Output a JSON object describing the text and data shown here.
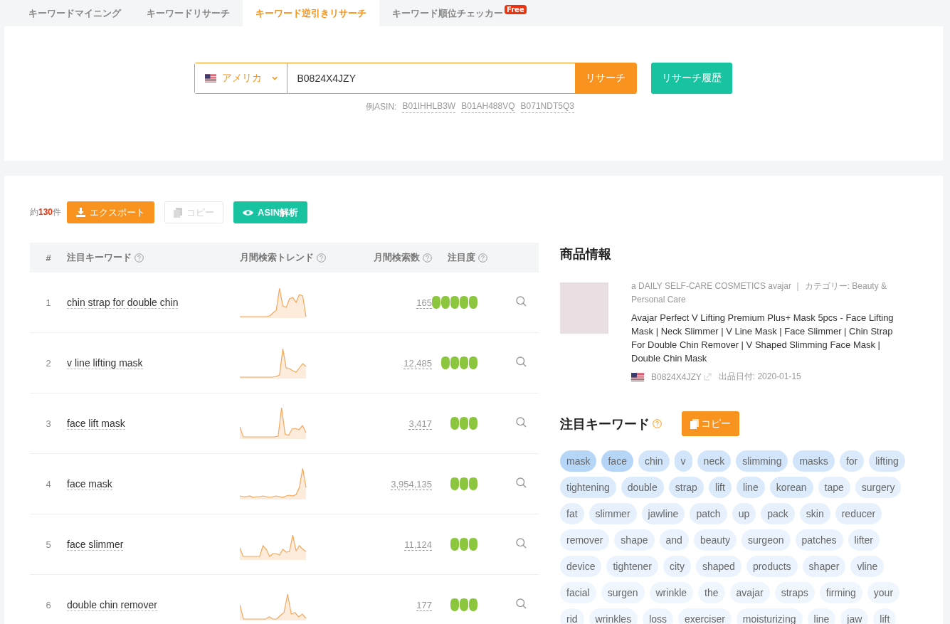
{
  "tabs": [
    {
      "label": "キーワードマイニング",
      "selected": false
    },
    {
      "label": "キーワードリサーチ",
      "selected": false
    },
    {
      "label": "キーワード逆引きリサーチ",
      "selected": true
    },
    {
      "label": "キーワード順位チェッカー",
      "selected": false,
      "badge": "Free"
    }
  ],
  "search": {
    "country": "アメリカ",
    "value": "B0824X4JZY",
    "button": "リサーチ",
    "history_button": "リサーチ履歴",
    "example_label": "例ASIN:",
    "examples": [
      "B01IHHLB3W",
      "B01AH488VQ",
      "B071NDT5Q3"
    ]
  },
  "results": {
    "count_prefix": "約",
    "count": "130",
    "count_suffix": "件",
    "buttons": [
      {
        "kind": "export",
        "label": "エクスポート",
        "disabled": false
      },
      {
        "kind": "copy",
        "label": "コピー",
        "disabled": true
      },
      {
        "kind": "analyze",
        "label": "ASIN解析",
        "disabled": false
      }
    ]
  },
  "table": {
    "columns": [
      {
        "label": "#",
        "help": false
      },
      {
        "label": "注目キーワード",
        "help": true
      },
      {
        "label": "月間検索トレンド",
        "help": true
      },
      {
        "label": "月間検索数",
        "help": true
      },
      {
        "label": "注目度",
        "help": true
      }
    ],
    "rows": [
      {
        "index": "1",
        "keyword": "chin strap for double chin",
        "searches": "165",
        "stars": 5
      },
      {
        "index": "2",
        "keyword": "v line lifting mask",
        "searches": "12,485",
        "stars": 4
      },
      {
        "index": "3",
        "keyword": "face lift mask",
        "searches": "3,417",
        "stars": 3
      },
      {
        "index": "4",
        "keyword": "face mask",
        "searches": "3,954,135",
        "stars": 3
      },
      {
        "index": "5",
        "keyword": "face slimmer",
        "searches": "11,124",
        "stars": 3
      },
      {
        "index": "6",
        "keyword": "double chin remover",
        "searches": "177",
        "stars": 3
      }
    ]
  },
  "product": {
    "title": "商品情報",
    "brand_line": "a DAILY SELF-CARE COSMETICS avajar ｜ カテゴリー: Beauty & Personal Care",
    "name": "Avajar Perfect V Lifting Premium Plus+ Mask 5pcs - Face Lifting Mask | Neck Slimmer | V Line Mask | Face Slimmer | Chin Strap For Double Chin Remover | V Shaped Slimming Face Mask | Double Chin Mask",
    "asin": "B0824X4JZY",
    "date": "出品日付: 2020-01-15"
  },
  "keywords": {
    "title": "注目キーワード",
    "copy_button": "コピー",
    "tags": [
      {
        "text": "mask",
        "color": "#b6d6f8"
      },
      {
        "text": "face",
        "color": "#b6d6f8"
      },
      {
        "text": "chin",
        "color": "#d2e5fb"
      },
      {
        "text": "v",
        "color": "#d2e5fb"
      },
      {
        "text": "neck",
        "color": "#d2e5fb"
      },
      {
        "text": "slimming",
        "color": "#d2e5fb"
      },
      {
        "text": "masks",
        "color": "#d2e5fb"
      },
      {
        "text": "for",
        "color": "#dcebfc"
      },
      {
        "text": "lifting",
        "color": "#dcebfc"
      },
      {
        "text": "tightening",
        "color": "#dcebfc"
      },
      {
        "text": "double",
        "color": "#dcebfc"
      },
      {
        "text": "strap",
        "color": "#dcebfc"
      },
      {
        "text": "lift",
        "color": "#dcebfc"
      },
      {
        "text": "line",
        "color": "#dcebfc"
      },
      {
        "text": "korean",
        "color": "#dcebfc"
      },
      {
        "text": "tape",
        "color": "#e6f1fd"
      },
      {
        "text": "surgery",
        "color": "#e6f1fd"
      },
      {
        "text": "fat",
        "color": "#e6f1fd"
      },
      {
        "text": "slimmer",
        "color": "#e6f1fd"
      },
      {
        "text": "jawline",
        "color": "#e6f1fd"
      },
      {
        "text": "patch",
        "color": "#e6f1fd"
      },
      {
        "text": "up",
        "color": "#e6f1fd"
      },
      {
        "text": "pack",
        "color": "#e6f1fd"
      },
      {
        "text": "skin",
        "color": "#e6f1fd"
      },
      {
        "text": "reducer",
        "color": "#e6f1fd"
      },
      {
        "text": "remover",
        "color": "#ebf4fe"
      },
      {
        "text": "shape",
        "color": "#ebf4fe"
      },
      {
        "text": "and",
        "color": "#ebf4fe"
      },
      {
        "text": "beauty",
        "color": "#ebf4fe"
      },
      {
        "text": "surgeon",
        "color": "#ebf4fe"
      },
      {
        "text": "patches",
        "color": "#ebf4fe"
      },
      {
        "text": "lifter",
        "color": "#ebf4fe"
      },
      {
        "text": "device",
        "color": "#ebf4fe"
      },
      {
        "text": "tightener",
        "color": "#ebf4fe"
      },
      {
        "text": "city",
        "color": "#ebf4fe"
      },
      {
        "text": "shaped",
        "color": "#ebf4fe"
      },
      {
        "text": "products",
        "color": "#ebf4fe"
      },
      {
        "text": "shaper",
        "color": "#ebf4fe"
      },
      {
        "text": "vline",
        "color": "#ebf4fe"
      },
      {
        "text": "facial",
        "color": "#f0f6fe"
      },
      {
        "text": "surgen",
        "color": "#f0f6fe"
      },
      {
        "text": "wrinkle",
        "color": "#f0f6fe"
      },
      {
        "text": "the",
        "color": "#f0f6fe"
      },
      {
        "text": "avajar",
        "color": "#f0f6fe"
      },
      {
        "text": "straps",
        "color": "#f0f6fe"
      },
      {
        "text": "firming",
        "color": "#f0f6fe"
      },
      {
        "text": "your",
        "color": "#f0f6fe"
      },
      {
        "text": "rid",
        "color": "#f0f6fe"
      },
      {
        "text": "wrinkles",
        "color": "#f0f6fe"
      },
      {
        "text": "loss",
        "color": "#f0f6fe"
      },
      {
        "text": "exerciser",
        "color": "#f0f6fe"
      },
      {
        "text": "moisturizing",
        "color": "#f0f6fe"
      },
      {
        "text": "line",
        "color": "#f0f6fe"
      },
      {
        "text": "jaw",
        "color": "#f0f6fe"
      },
      {
        "text": "lift",
        "color": "#f0f6fe"
      }
    ]
  }
}
